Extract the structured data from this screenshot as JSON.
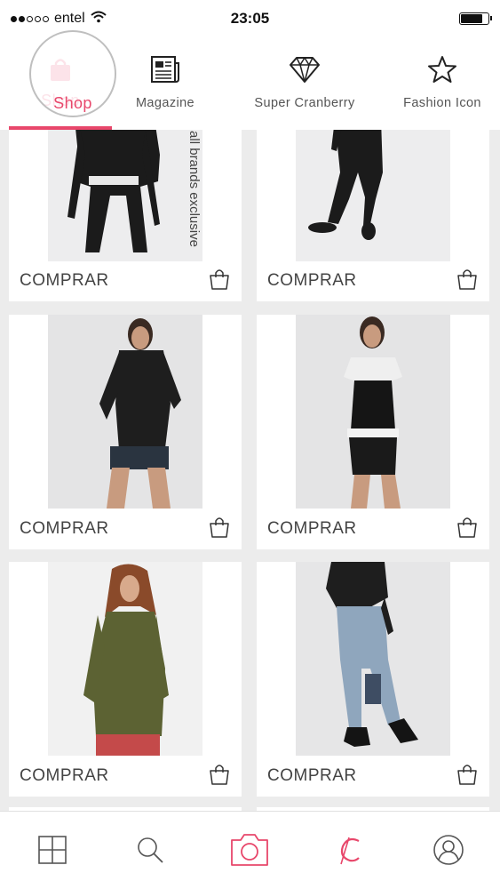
{
  "status_bar": {
    "carrier": "entel",
    "time": "23:05",
    "signal_bars": 2,
    "battery_level": 0.8,
    "icons": [
      "signal-dots-icon",
      "wifi-icon",
      "battery-icon"
    ]
  },
  "tabs": [
    {
      "label": "Shop",
      "icon": "shopping-bag-icon",
      "active": true
    },
    {
      "label": "Magazine",
      "icon": "newspaper-icon",
      "active": false
    },
    {
      "label": "Super Cranberry",
      "icon": "diamond-icon",
      "active": false
    },
    {
      "label": "Fashion Icon",
      "icon": "star-icon",
      "active": false
    }
  ],
  "products": [
    {
      "buy_label": "COMPRAR",
      "photo_text": "all brands exclusive"
    },
    {
      "buy_label": "COMPRAR"
    },
    {
      "buy_label": "COMPRAR"
    },
    {
      "buy_label": "COMPRAR"
    },
    {
      "buy_label": "COMPRAR"
    },
    {
      "buy_label": "COMPRAR"
    }
  ],
  "bottom_nav": [
    {
      "icon": "grid-icon"
    },
    {
      "icon": "search-icon"
    },
    {
      "icon": "camera-icon"
    },
    {
      "icon": "cranberry-logo-icon"
    },
    {
      "icon": "profile-icon"
    }
  ],
  "colors": {
    "accent": "#e8476b",
    "background": "#ececec",
    "card": "#ffffff"
  }
}
